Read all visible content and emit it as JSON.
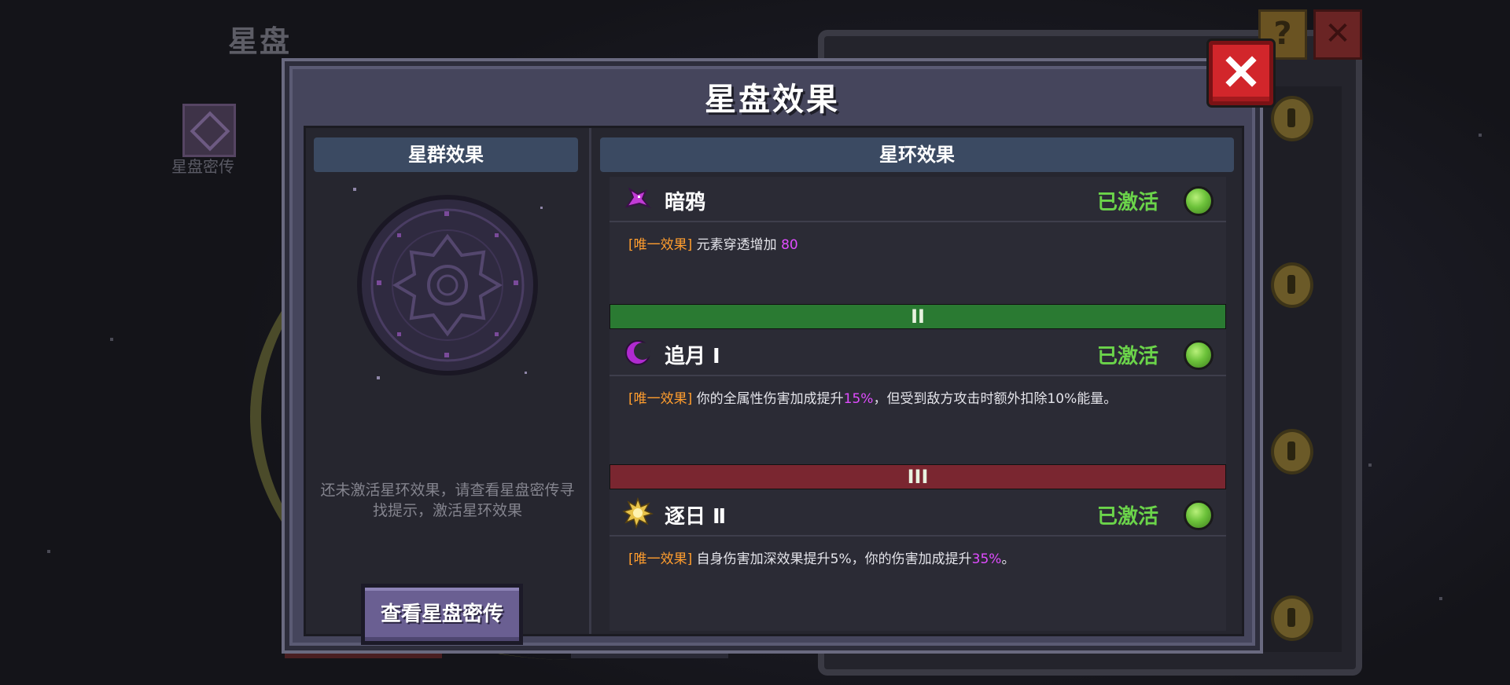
{
  "background": {
    "title": "星盘",
    "secret_label": "星盘密传",
    "help_label": "?"
  },
  "modal": {
    "title": "星盘效果",
    "close_label": "×"
  },
  "left_panel": {
    "header": "星群效果",
    "hint": "还未激活星环效果，请查看星盘密传寻找提示，激活星环效果",
    "button_label": "查看星盘密传"
  },
  "right_panel": {
    "header": "星环效果",
    "effects": [
      {
        "name": "暗鸦",
        "icon": "crow-icon",
        "status": "已激活",
        "tag": "[唯一效果]",
        "desc_before": "元素穿透增加",
        "desc_value": "80",
        "desc_after": ""
      },
      {
        "tier": "II",
        "name": "追月 Ⅰ",
        "icon": "crescent-moon-icon",
        "status": "已激活",
        "tag": "[唯一效果]",
        "desc_before": "你的全属性伤害加成提升",
        "desc_value": "15%",
        "desc_after": "，但受到敌方攻击时额外扣除10%能量。"
      },
      {
        "tier": "III",
        "name": "逐日 Ⅱ",
        "icon": "sun-icon",
        "status": "已激活",
        "tag": "[唯一效果]",
        "desc_before": "自身伤害加深效果提升5%，你的伤害加成提升",
        "desc_value": "35%",
        "desc_after": "。"
      }
    ]
  },
  "colors": {
    "status_active": "#6bd44a",
    "tag": "#ff9d2e",
    "value_highlight": "#e04cff",
    "tier2_bar": "#2a7a32",
    "tier3_bar": "#7a2630",
    "close_button": "#d2262b"
  }
}
